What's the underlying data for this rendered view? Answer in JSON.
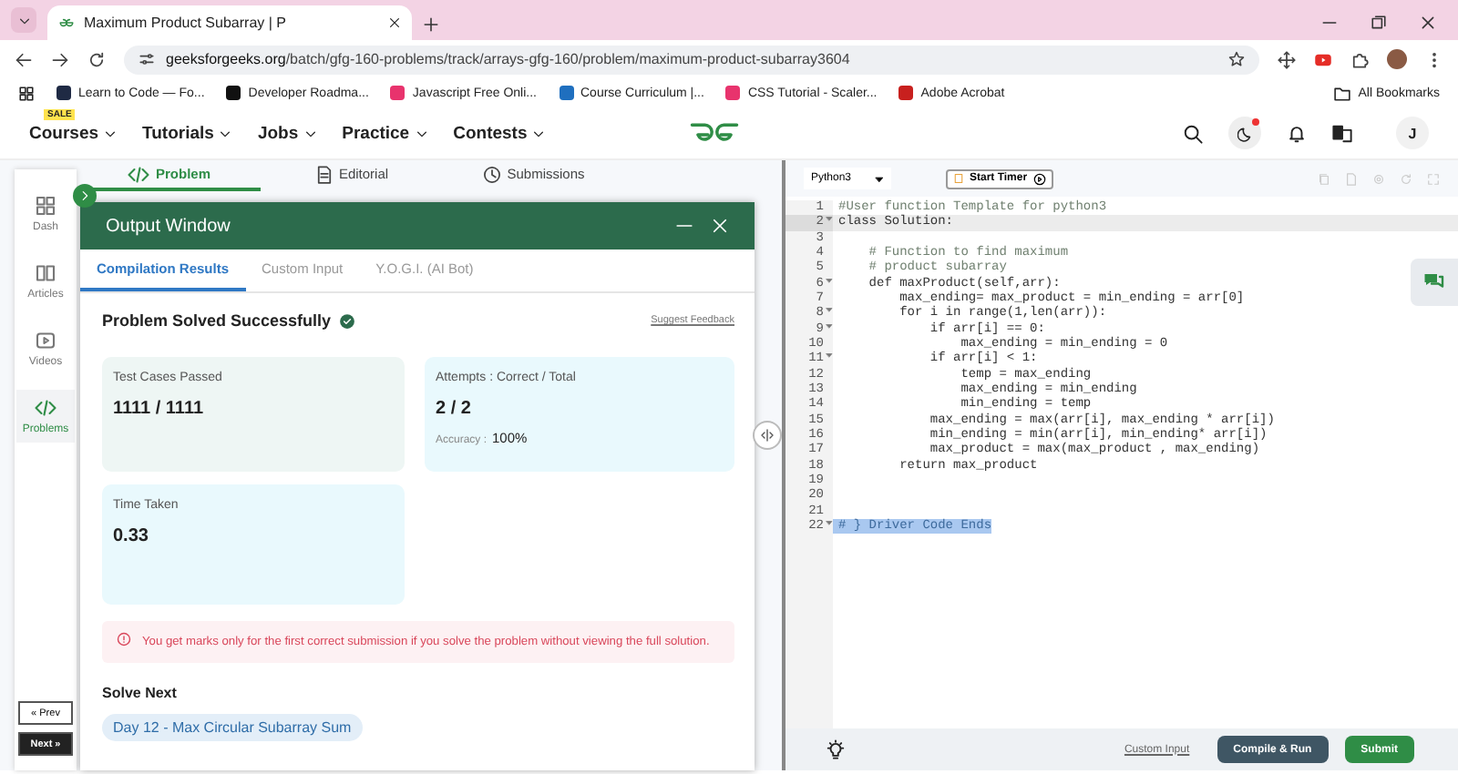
{
  "browser": {
    "tab_title": "Maximum Product Subarray | P",
    "url_domain": "geeksforgeeks.org",
    "url_path": "/batch/gfg-160-problems/track/arrays-gfg-160/problem/maximum-product-subarray3604",
    "bookmarks": [
      {
        "label": "Learn to Code — Fo...",
        "color": "#1f2a44"
      },
      {
        "label": "Developer Roadma...",
        "color": "#111111"
      },
      {
        "label": "Javascript Free Onli...",
        "color": "#e8336d"
      },
      {
        "label": "Course Curriculum |...",
        "color": "#1f6fbf"
      },
      {
        "label": "CSS Tutorial - Scaler...",
        "color": "#e8336d"
      },
      {
        "label": "Adobe Acrobat",
        "color": "#c8201e"
      }
    ],
    "all_bookmarks": "All Bookmarks"
  },
  "nav": {
    "sale_badge": "SALE",
    "menu": [
      "Courses",
      "Tutorials",
      "Jobs",
      "Practice",
      "Contests"
    ],
    "avatar": "J"
  },
  "sidebar": {
    "items": [
      {
        "label": "Dash",
        "selected": false
      },
      {
        "label": "Articles",
        "selected": false
      },
      {
        "label": "Videos",
        "selected": false
      },
      {
        "label": "Problems",
        "selected": true
      }
    ],
    "prev": "« Prev",
    "next": "Next »"
  },
  "problem_tabs": [
    {
      "label": "Problem",
      "selected": true
    },
    {
      "label": "Editorial",
      "selected": false
    },
    {
      "label": "Submissions",
      "selected": false
    }
  ],
  "output_window": {
    "title": "Output Window",
    "tabs": [
      {
        "label": "Compilation Results",
        "selected": true
      },
      {
        "label": "Custom Input",
        "selected": false
      },
      {
        "label": "Y.O.G.I. (AI Bot)",
        "selected": false
      }
    ],
    "status": "Problem Solved Successfully",
    "suggest_feedback": "Suggest Feedback",
    "stats": [
      {
        "label": "Test Cases Passed",
        "value": "1111 / 1111"
      },
      {
        "label": "Attempts : Correct / Total",
        "value": "2 / 2",
        "note_label": "Accuracy :",
        "note_value": "100%"
      },
      {
        "label": "Time Taken",
        "value": "0.33"
      }
    ],
    "notice": "You get marks only for the first correct submission if you solve the problem without viewing the full solution.",
    "solve_next_heading": "Solve Next",
    "next_problem": "Day 12 - Max Circular Subarray Sum"
  },
  "editor": {
    "language": "Python3",
    "start_timer": "Start Timer",
    "lines": [
      {
        "n": "1",
        "code": "#User function Template for python3",
        "fold": false,
        "active": false,
        "selected": false
      },
      {
        "n": "2",
        "code": "class Solution:",
        "fold": true,
        "active": true,
        "selected": false
      },
      {
        "n": "3",
        "fold": false,
        "active": false,
        "selected": false
      },
      {
        "n": "4",
        "code": "    # Function to find maximum",
        "fold": false,
        "active": false,
        "selected": false
      },
      {
        "n": "5",
        "code": "    # product subarray",
        "fold": false,
        "active": false,
        "selected": false
      },
      {
        "n": "6",
        "code": "    def maxProduct(self,arr):",
        "fold": true,
        "active": false,
        "selected": false
      },
      {
        "n": "7",
        "code": "        max_ending= max_product = min_ending = arr[0]",
        "fold": false,
        "active": false,
        "selected": false
      },
      {
        "n": "8",
        "code": "        for i in range(1,len(arr)):",
        "fold": true,
        "active": false,
        "selected": false
      },
      {
        "n": "9",
        "code": "            if arr[i] == 0:",
        "fold": true,
        "active": false,
        "selected": false
      },
      {
        "n": "10",
        "code": "                max_ending = min_ending = 0",
        "fold": false,
        "active": false,
        "selected": false
      },
      {
        "n": "11",
        "code": "            if arr[i] < 1:",
        "fold": true,
        "active": false,
        "selected": false
      },
      {
        "n": "12",
        "code": "                temp = max_ending",
        "fold": false,
        "active": false,
        "selected": false
      },
      {
        "n": "13",
        "code": "                max_ending = min_ending",
        "fold": false,
        "active": false,
        "selected": false
      },
      {
        "n": "14",
        "code": "                min_ending = temp",
        "fold": false,
        "active": false,
        "selected": false
      },
      {
        "n": "15",
        "code": "            max_ending = max(arr[i], max_ending * arr[i])",
        "fold": false,
        "active": false,
        "selected": false
      },
      {
        "n": "16",
        "code": "            min_ending = min(arr[i], min_ending* arr[i])",
        "fold": false,
        "active": false,
        "selected": false
      },
      {
        "n": "17",
        "code": "            max_product = max(max_product , max_ending)",
        "fold": false,
        "active": false,
        "selected": false
      },
      {
        "n": "18",
        "code": "        return max_product",
        "fold": false,
        "active": false,
        "selected": false
      },
      {
        "n": "19",
        "fold": false,
        "active": false,
        "selected": false
      },
      {
        "n": "20",
        "fold": false,
        "active": false,
        "selected": false
      },
      {
        "n": "21",
        "fold": false,
        "active": false,
        "selected": false
      },
      {
        "n": "22",
        "code": "# } Driver Code Ends",
        "fold": true,
        "active": false,
        "selected": true
      }
    ],
    "custom_input": "Custom Input",
    "compile_run": "Compile & Run",
    "submit": "Submit"
  }
}
